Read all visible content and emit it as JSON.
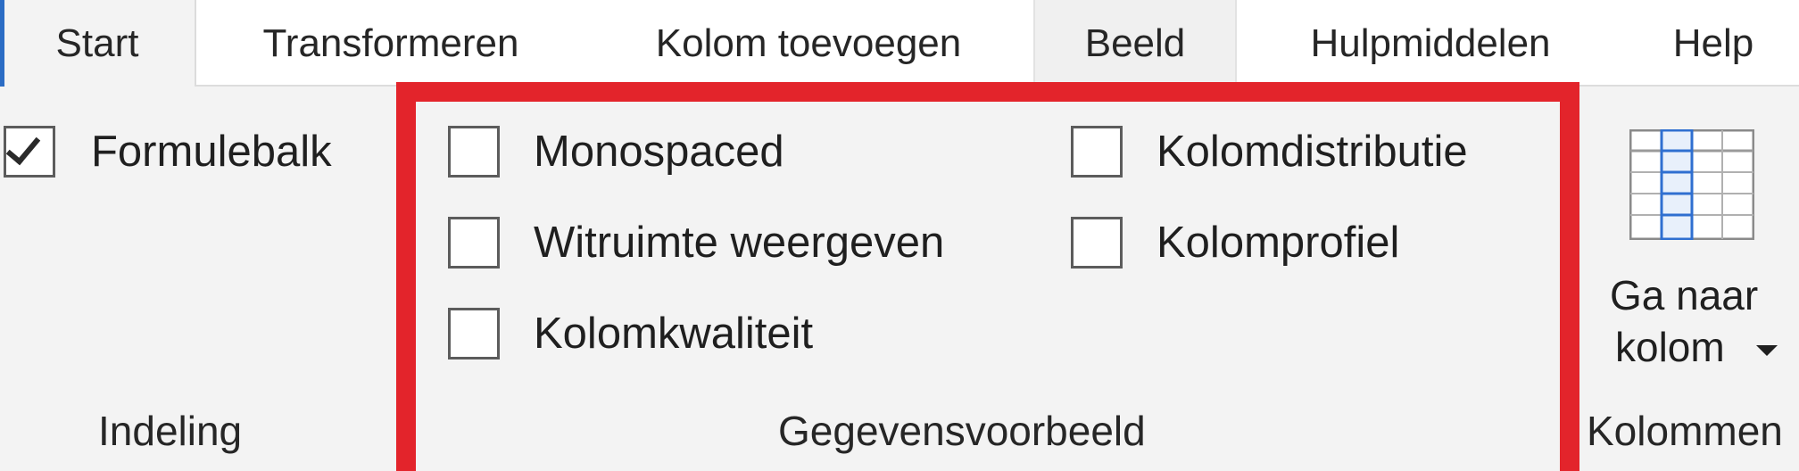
{
  "tabs": {
    "start": "Start",
    "transformeren": "Transformeren",
    "kolom_toevoegen": "Kolom toevoegen",
    "beeld": "Beeld",
    "hulpmiddelen": "Hulpmiddelen",
    "help": "Help"
  },
  "indeling": {
    "formulebalk": {
      "label": "Formulebalk",
      "checked": true
    },
    "group_label": "Indeling"
  },
  "gegevensvoorbeeld": {
    "monospaced": {
      "label": "Monospaced",
      "checked": false
    },
    "witruimte": {
      "label": "Witruimte weergeven",
      "checked": false
    },
    "kolomkwaliteit": {
      "label": "Kolomkwaliteit",
      "checked": false
    },
    "kolomdistributie": {
      "label": "Kolomdistributie",
      "checked": false
    },
    "kolomprofiel": {
      "label": "Kolomprofiel",
      "checked": false
    },
    "group_label": "Gegevensvoorbeeld"
  },
  "kolommen": {
    "ga_naar_kolom_line1": "Ga naar",
    "ga_naar_kolom_line2": "kolom",
    "group_label": "Kolommen"
  },
  "colors": {
    "highlight": "#e3242b",
    "accent": "#2b6cc4"
  }
}
